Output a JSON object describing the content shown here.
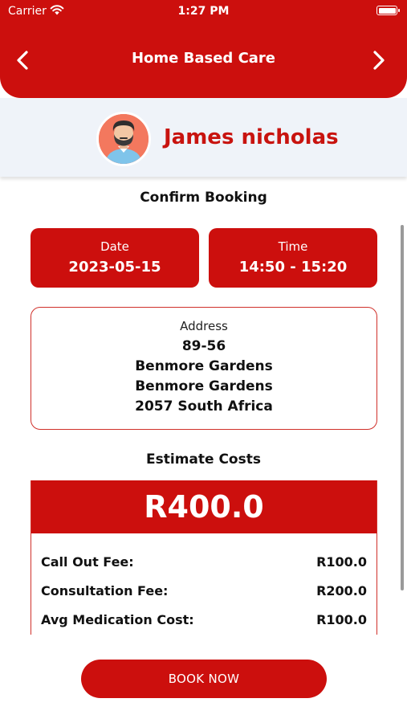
{
  "status_bar": {
    "carrier": "Carrier",
    "time": "1:27 PM"
  },
  "header": {
    "title": "Home Based Care"
  },
  "patient": {
    "name": "James nicholas"
  },
  "booking": {
    "title": "Confirm Booking",
    "date_label": "Date",
    "date_value": "2023-05-15",
    "time_label": "Time",
    "time_value": "14:50 - 15:20"
  },
  "address": {
    "label": "Address",
    "lines": [
      "89-56",
      "Benmore Gardens",
      "Benmore Gardens",
      "2057 South Africa"
    ]
  },
  "costs": {
    "title": "Estimate Costs",
    "total": "R400.0",
    "items": [
      {
        "label": "Call Out  Fee:",
        "value": "R100.0"
      },
      {
        "label": "Consultation Fee:",
        "value": "R200.0"
      },
      {
        "label": "Avg Medication Cost:",
        "value": "R100.0"
      }
    ]
  },
  "actions": {
    "book_label": "BOOK NOW"
  },
  "colors": {
    "primary": "#cc0f0d",
    "profile_bg": "#eff3f9",
    "name_red": "#c8130f",
    "avatar_bg": "#f3785e"
  },
  "icons": [
    "wifi-icon",
    "battery-icon",
    "back-chevron-icon",
    "next-chevron-icon",
    "avatar-icon"
  ]
}
